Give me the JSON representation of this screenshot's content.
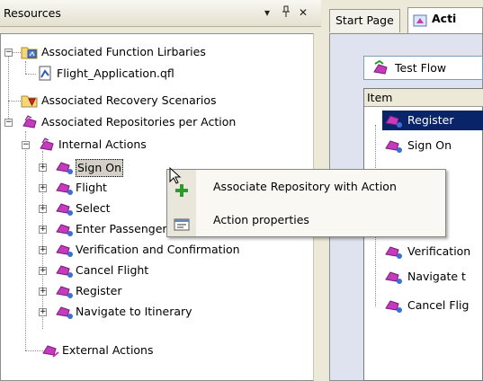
{
  "resources_pane": {
    "title": "Resources",
    "controls": {
      "dropdown": "▾",
      "pin": "ᵽ",
      "close": "✕"
    }
  },
  "tree": {
    "function_libraries": "Associated Function Lirbaries",
    "flight_application": "Flight_Application.qfl",
    "recovery_scenarios": "Associated Recovery Scenarios",
    "repositories_per_action": "Associated Repositories per Action",
    "internal_actions": "Internal Actions",
    "actions": [
      "Sign On",
      "Flight",
      "Select",
      "Enter Passenger Details",
      "Verification and Confirmation",
      "Cancel Flight",
      "Register",
      "Navigate to Itinerary"
    ],
    "external_actions": "External Actions"
  },
  "tabs": {
    "start_page": "Start Page",
    "active": "Acti"
  },
  "flow": {
    "label": "Test Flow"
  },
  "grid": {
    "column": "Item",
    "rows": [
      "Register",
      "Sign On",
      "Verification",
      "Navigate t",
      "Cancel Flig"
    ]
  },
  "context_menu": {
    "associate": "Associate Repository with Action",
    "properties": "Action properties"
  },
  "colors": {
    "selection": "#0a246a",
    "action_icon": "#b52bb1",
    "pane_bg": "#ece9d8"
  }
}
